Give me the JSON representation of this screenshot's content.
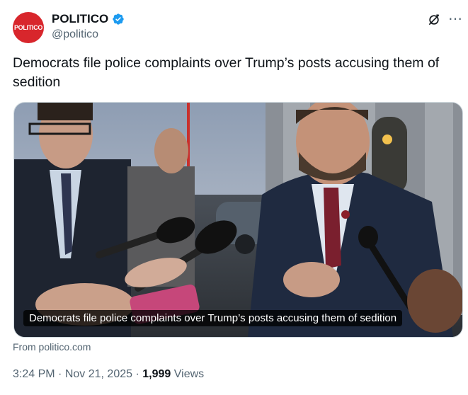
{
  "account": {
    "avatar_text": "POLITICO",
    "display_name": "POLITICO",
    "handle": "@politico"
  },
  "tweet": {
    "text": "Democrats file police complaints over Trump’s posts accusing them of sedition"
  },
  "card": {
    "caption": "Democrats file police complaints over Trump’s posts accusing them of sedition",
    "source": "From politico.com"
  },
  "meta": {
    "time": "3:24 PM",
    "date": "Nov 21, 2025",
    "views_count": "1,999",
    "views_label": "Views",
    "separator": "·"
  },
  "icons": {
    "verified": "verified-badge-icon",
    "grok": "grok-icon",
    "more": "more-icon"
  },
  "colors": {
    "brand_red": "#d8262c",
    "verified_blue": "#1d9bf0",
    "secondary_text": "#536471"
  }
}
